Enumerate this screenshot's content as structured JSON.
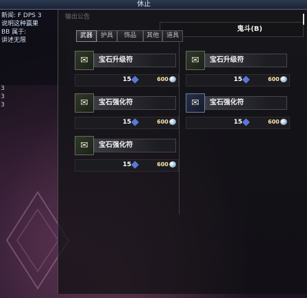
{
  "window_title": "休止",
  "background_panel_title": "输出公告",
  "chat": {
    "lines": [
      "新闻: F DPS 3",
      "说明这种赢果",
      "BB  属于:",
      "讲述无限"
    ]
  },
  "side_labels": [
    "3",
    "3",
    "3"
  ],
  "shop": {
    "header_label": "鬼斗(B)",
    "tabs": [
      "武器",
      "护具",
      "饰品",
      "其他",
      "道具"
    ],
    "items": [
      {
        "name": "宝石升级符",
        "level": "15",
        "price": "600",
        "col": 0,
        "row": 0,
        "style": "green"
      },
      {
        "name": "宝石升级符",
        "level": "15",
        "price": "600",
        "col": 1,
        "row": 0,
        "style": "green"
      },
      {
        "name": "宝石强化符",
        "level": "15",
        "price": "600",
        "col": 0,
        "row": 1,
        "style": "green"
      },
      {
        "name": "宝石强化符",
        "level": "15",
        "price": "600",
        "col": 1,
        "row": 1,
        "style": "blue"
      },
      {
        "name": "宝石强化符",
        "level": "15",
        "price": "600",
        "col": 0,
        "row": 2,
        "style": "green"
      }
    ]
  },
  "icons": {
    "item": "scroll-icon",
    "gem": "gem-icon",
    "coin": "coin-icon"
  }
}
